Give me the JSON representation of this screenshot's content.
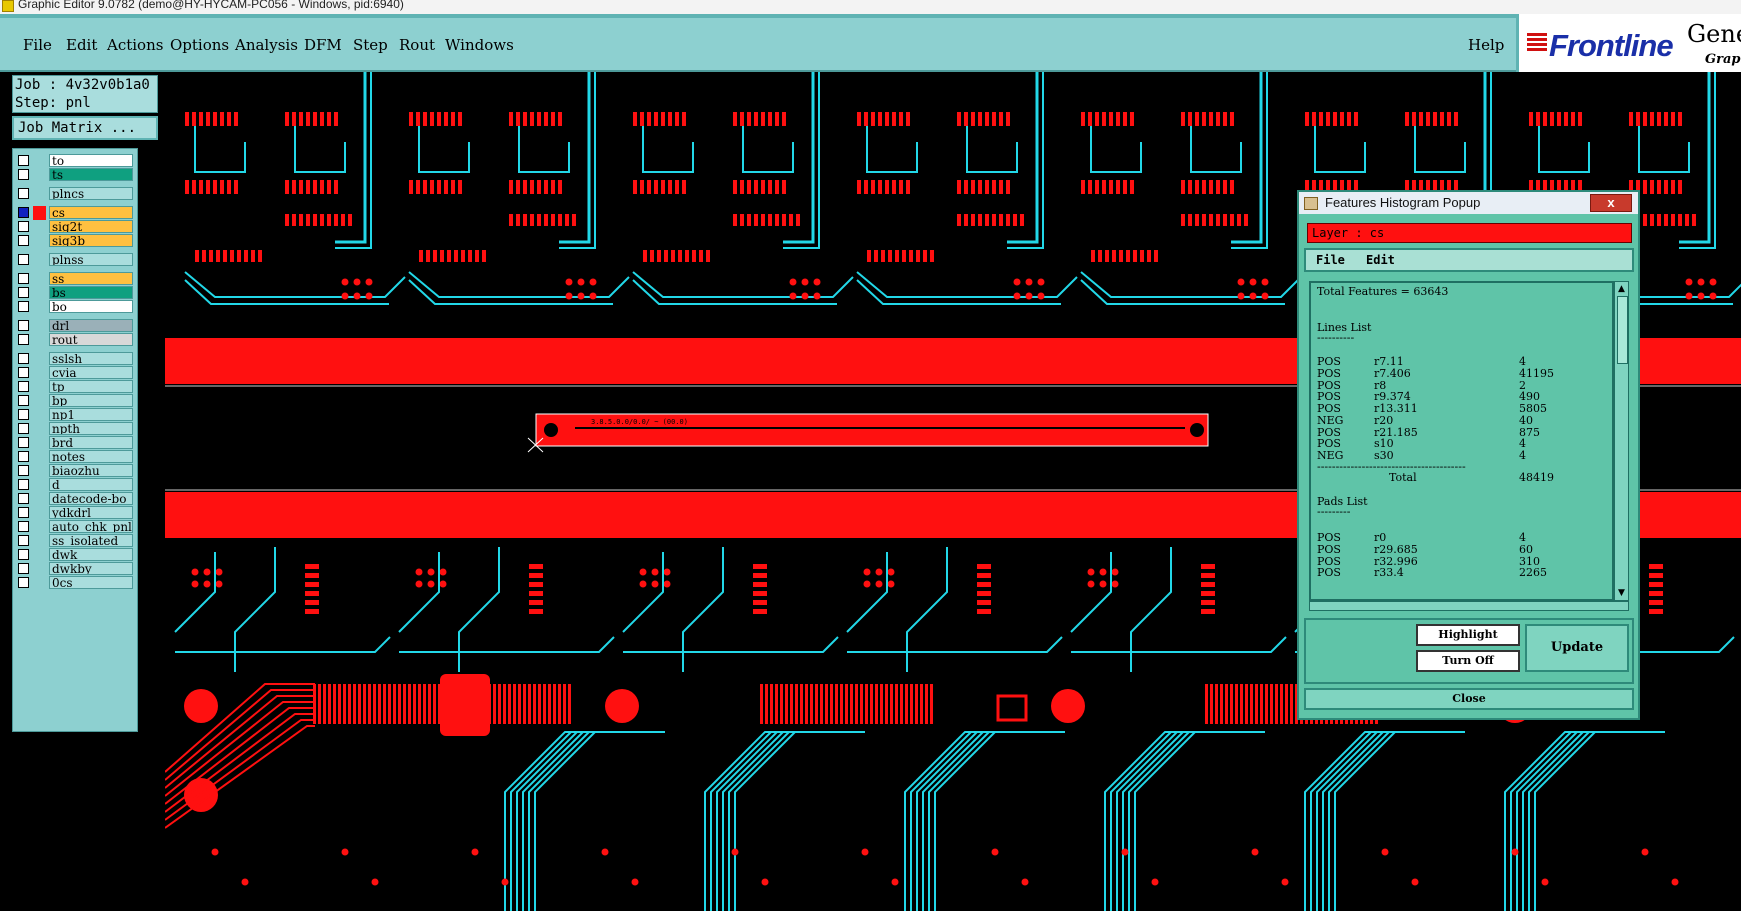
{
  "window": {
    "title": "Graphic Editor 9.0782 (demo@HY-HYCAM-PC056 - Windows, pid:6940)"
  },
  "menu": {
    "items": [
      "File",
      "Edit",
      "Actions",
      "Options",
      "Analysis",
      "DFM",
      "Step",
      "Rout",
      "Windows"
    ],
    "help": "Help"
  },
  "logo": {
    "brand": "Frontline",
    "product": "Genes",
    "tagline": "Graph"
  },
  "job": {
    "job_line": "Job : 4v32v0b1a0",
    "step_line": "Step: pnl",
    "matrix_button": "Job Matrix ..."
  },
  "layers": [
    {
      "name": "to",
      "color": "#ffffff"
    },
    {
      "name": "ts",
      "color": "#0fa080"
    },
    {
      "name": "plncs",
      "color": "#a9dddd"
    },
    {
      "name": "cs",
      "color": "#ffc040",
      "active": true
    },
    {
      "name": "sig2t",
      "color": "#ffc040"
    },
    {
      "name": "sig3b",
      "color": "#ffc040"
    },
    {
      "name": "plnss",
      "color": "#a9dddd"
    },
    {
      "name": "ss",
      "color": "#ffc040"
    },
    {
      "name": "bs",
      "color": "#0fa080"
    },
    {
      "name": "bo",
      "color": "#ffffff"
    },
    {
      "name": "drl",
      "color": "#9ab0b8"
    },
    {
      "name": "rout",
      "color": "#d8d8d8"
    },
    {
      "name": "sslsh",
      "color": "#a9dddd"
    },
    {
      "name": "cvia",
      "color": "#a9dddd"
    },
    {
      "name": "tp",
      "color": "#a9dddd"
    },
    {
      "name": "bp",
      "color": "#a9dddd"
    },
    {
      "name": "np1",
      "color": "#a9dddd"
    },
    {
      "name": "npth",
      "color": "#a9dddd"
    },
    {
      "name": "brd",
      "color": "#a9dddd"
    },
    {
      "name": "notes",
      "color": "#a9dddd"
    },
    {
      "name": "biaozhu",
      "color": "#a9dddd"
    },
    {
      "name": "d",
      "color": "#a9dddd"
    },
    {
      "name": "datecode-bo",
      "color": "#a9dddd"
    },
    {
      "name": "ydkdrl",
      "color": "#a9dddd"
    },
    {
      "name": "auto_chk_pnl",
      "color": "#a9dddd"
    },
    {
      "name": "ss_isolated",
      "color": "#a9dddd"
    },
    {
      "name": "dwk",
      "color": "#a9dddd"
    },
    {
      "name": "dwkby",
      "color": "#a9dddd"
    },
    {
      "name": "0cs",
      "color": "#a9dddd"
    }
  ],
  "board": {
    "label_text": "3.8.5.0.0/0.0/ ~ (00.0)"
  },
  "popup": {
    "title": "Features Histogram Popup",
    "close_x": "x",
    "layer_label": "Layer :  cs",
    "menu": [
      "File",
      "Edit"
    ],
    "total_features": "Total Features = 63643",
    "lines_header": "Lines List",
    "lines_underline": "----------",
    "lines": [
      {
        "pol": "POS",
        "sym": "r7.11",
        "count": "4"
      },
      {
        "pol": "POS",
        "sym": "r7.406",
        "count": "41195"
      },
      {
        "pol": "POS",
        "sym": "r8",
        "count": "2"
      },
      {
        "pol": "POS",
        "sym": "r9.374",
        "count": "490"
      },
      {
        "pol": "POS",
        "sym": "r13.311",
        "count": "5805"
      },
      {
        "pol": "NEG",
        "sym": "r20",
        "count": "40"
      },
      {
        "pol": "POS",
        "sym": "r21.185",
        "count": "875"
      },
      {
        "pol": "POS",
        "sym": "s10",
        "count": "4"
      },
      {
        "pol": "NEG",
        "sym": "s30",
        "count": "4"
      }
    ],
    "separator": "----------------------------------------",
    "total_label": "Total",
    "total_value": "48419",
    "pads_header": "Pads List",
    "pads_underline": "---------",
    "pads": [
      {
        "pol": "POS",
        "sym": "r0",
        "count": "4"
      },
      {
        "pol": "POS",
        "sym": "r29.685",
        "count": "60"
      },
      {
        "pol": "POS",
        "sym": "r32.996",
        "count": "310"
      },
      {
        "pol": "POS",
        "sym": "r33.4",
        "count": "2265"
      }
    ],
    "buttons": {
      "highlight": "Highlight",
      "turn_off": "Turn Off",
      "update": "Update",
      "close": "Close"
    }
  }
}
